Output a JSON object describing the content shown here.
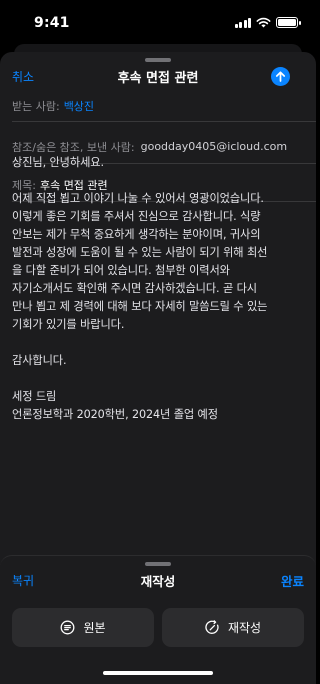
{
  "status_bar": {
    "time": "9:41"
  },
  "compose": {
    "cancel_label": "취소",
    "title": "후속 면접 관련",
    "to_label": "받는 사람:",
    "to_value": "백상진",
    "cc_label": "참조/숨은 참조, 보낸 사람:",
    "cc_value": "goodday0405@icloud.com",
    "subject_label": "제목:",
    "subject_value": "후속 면접 관련",
    "body_lines": [
      "상진님, 안녕하세요.",
      "",
      "어제 직접 뵙고 이야기 나눌 수 있어서 영광이었습니다.",
      "이렇게 좋은 기회를 주셔서 진심으로 감사합니다. 식량",
      "안보는 제가 무척 중요하게 생각하는 분야이며, 귀사의",
      "발전과 성장에 도움이 될 수 있는 사람이 되기 위해 최선",
      "을 다할 준비가 되어 있습니다. 첨부한 이력서와",
      "자기소개서도 확인해 주시면 감사하겠습니다. 곧 다시",
      "만나 뵙고 제 경력에 대해 보다 자세히 말씀드릴 수 있는",
      "기회가 있기를 바랍니다.",
      "",
      "감사합니다.",
      "",
      "세정 드림",
      "언론정보학과 2020학번, 2024년 졸업 예정"
    ]
  },
  "writing_tools": {
    "revert_label": "복귀",
    "title": "재작성",
    "done_label": "완료",
    "original_label": "원본",
    "rewrite_label": "재작성"
  },
  "colors": {
    "accent": "#0a84ff",
    "sheet": "#1c1c1e",
    "button": "#2c2c2e"
  }
}
